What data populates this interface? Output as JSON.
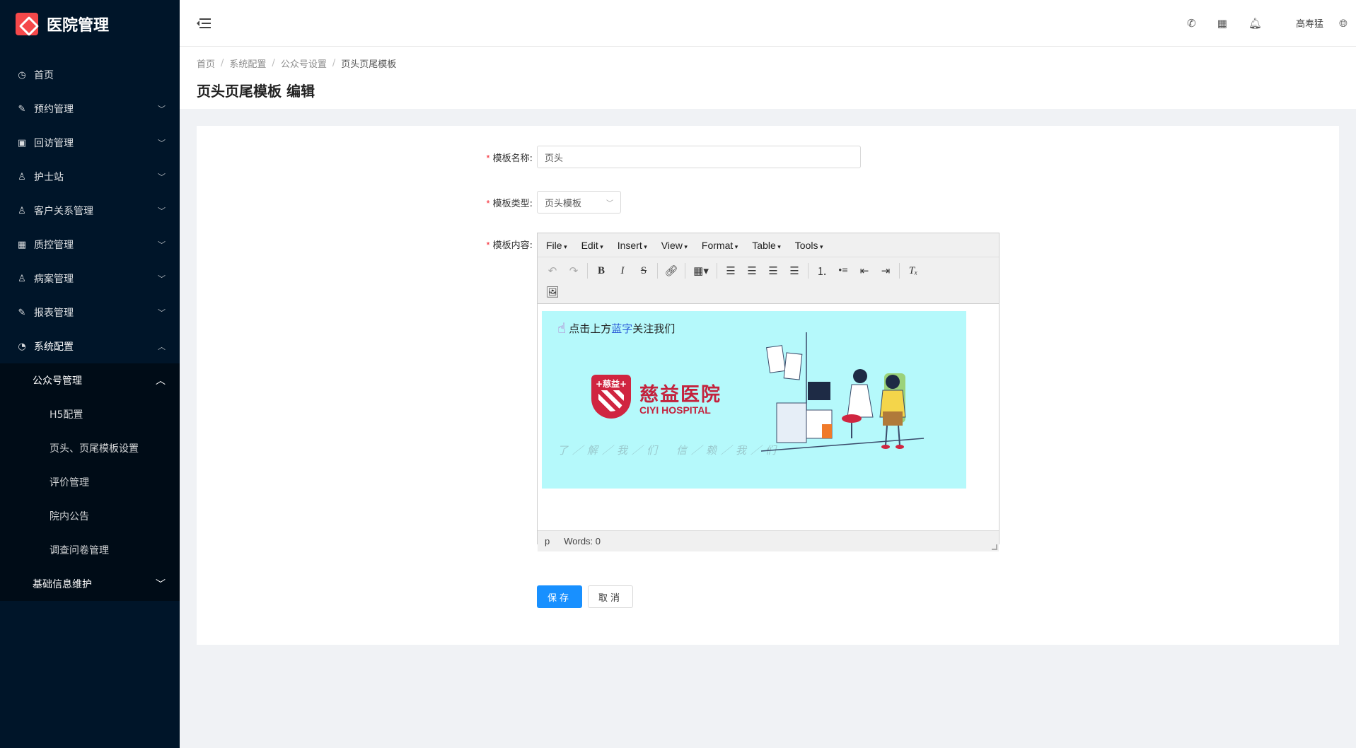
{
  "app": {
    "title": "医院管理"
  },
  "sidebar": {
    "items": [
      {
        "label": "首页",
        "icon": "dashboard-icon"
      },
      {
        "label": "预约管理",
        "icon": "edit-icon"
      },
      {
        "label": "回访管理",
        "icon": "lock-icon"
      },
      {
        "label": "护士站",
        "icon": "user-icon"
      },
      {
        "label": "客户关系管理",
        "icon": "user-icon"
      },
      {
        "label": "质控管理",
        "icon": "table-icon"
      },
      {
        "label": "病案管理",
        "icon": "user-icon"
      },
      {
        "label": "报表管理",
        "icon": "edit-icon"
      },
      {
        "label": "系统配置",
        "icon": "gauge-icon"
      }
    ],
    "submenu": {
      "title": "公众号管理",
      "leaves": [
        "H5配置",
        "页头、页尾模板设置",
        "评价管理",
        "院内公告",
        "调查问卷管理"
      ]
    },
    "basic": {
      "label": "基础信息维护"
    }
  },
  "header": {
    "user": "高寿猛"
  },
  "breadcrumb": [
    "首页",
    "系统配置",
    "公众号设置",
    "页头页尾模板"
  ],
  "page": {
    "title": "页头页尾模板 编辑"
  },
  "form": {
    "name_label": "模板名称:",
    "name_value": "页头",
    "type_label": "模板类型:",
    "type_value": "页头模板",
    "content_label": "模板内容:"
  },
  "editor": {
    "menus": [
      "File",
      "Edit",
      "Insert",
      "View",
      "Format",
      "Table",
      "Tools"
    ],
    "status_path": "p",
    "status_words": "Words: 0"
  },
  "banner": {
    "top_a": "点击上方",
    "top_blue": "蓝字",
    "top_b": "关注我们",
    "logo_tag": "+慈益+",
    "brand_cn": "慈益医院",
    "brand_en": "CIYI HOSPITAL",
    "slogan": "了／解／我／们　信／赖／我／们"
  },
  "buttons": {
    "save": "保存",
    "cancel": "取消"
  }
}
